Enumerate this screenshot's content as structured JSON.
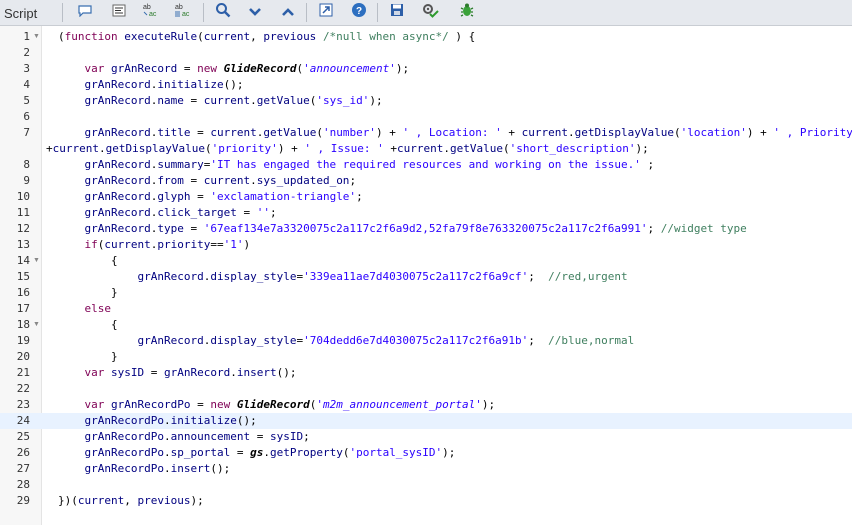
{
  "toolbar": {
    "label": "Script",
    "buttons": [
      {
        "name": "comment-button",
        "icon": "speech-bubble-icon"
      },
      {
        "name": "format-button",
        "icon": "align-lines-icon"
      },
      {
        "name": "replace-button",
        "icon": "ab-ac-icon"
      },
      {
        "name": "replace-all-button",
        "icon": "ab-ac-all-icon"
      },
      {
        "name": "search-button",
        "icon": "search-icon"
      },
      {
        "name": "next-button",
        "icon": "chevron-down-icon"
      },
      {
        "name": "previous-button",
        "icon": "chevron-up-icon"
      },
      {
        "name": "open-new-window-button",
        "icon": "external-link-icon"
      },
      {
        "name": "help-button",
        "icon": "help-icon"
      },
      {
        "name": "save-button",
        "icon": "floppy-disk-icon"
      },
      {
        "name": "check-syntax-button",
        "icon": "gear-check-icon"
      },
      {
        "name": "debug-button",
        "icon": "bug-icon"
      }
    ]
  },
  "editor": {
    "active_line": 24,
    "lines": [
      "(function executeRule(current, previous /*null when async*/ ) {",
      "",
      "    var grAnRecord = new GlideRecord('announcement');",
      "    grAnRecord.initialize();",
      "    grAnRecord.name = current.getValue('sys_id');",
      "",
      "    grAnRecord.title = current.getValue('number') + ' , Location: ' + current.getDisplayValue('location') + ' , Priority: ' ",
      "    grAnRecord.summary='IT has engaged the required resources and working on the issue.' ;",
      "    grAnRecord.from = current.sys_updated_on;",
      "    grAnRecord.glyph = 'exclamation-triangle';",
      "    grAnRecord.click_target = '';",
      "    grAnRecord.type = '67eaf134e7a3320075c2a117c2f6a9d2,52fa79f8e763320075c2a117c2f6a991'; //widget type",
      "    if(current.priority=='1')",
      "        {",
      "            grAnRecord.display_style='339ea11ae7d4030075c2a117c2f6a9cf';  //red,urgent",
      "        }",
      "    else",
      "        {",
      "            grAnRecord.display_style='704dedd6e7d4030075c2a117c2f6a91b';  //blue,normal",
      "        }",
      "    var sysID = grAnRecord.insert();",
      "",
      "    var grAnRecordPo = new GlideRecord('m2m_announcement_portal');",
      "    grAnRecordPo.initialize();",
      "    grAnRecordPo.announcement = sysID;",
      "    grAnRecordPo.sp_portal = gs.getProperty('portal_sysID');",
      "    grAnRecordPo.insert();",
      "",
      "})(current, previous);"
    ],
    "wrapped_line_7": "+current.getDisplayValue('priority') + ' , Issue: ' +current.getValue('short_description');",
    "fold_lines": [
      1,
      14,
      18
    ],
    "colors": {
      "keyword": "#7f0055",
      "identifier": "#000080",
      "string": "#2a00ff",
      "comment": "#3f7f5f",
      "active_line_bg": "#e8f2ff"
    }
  }
}
